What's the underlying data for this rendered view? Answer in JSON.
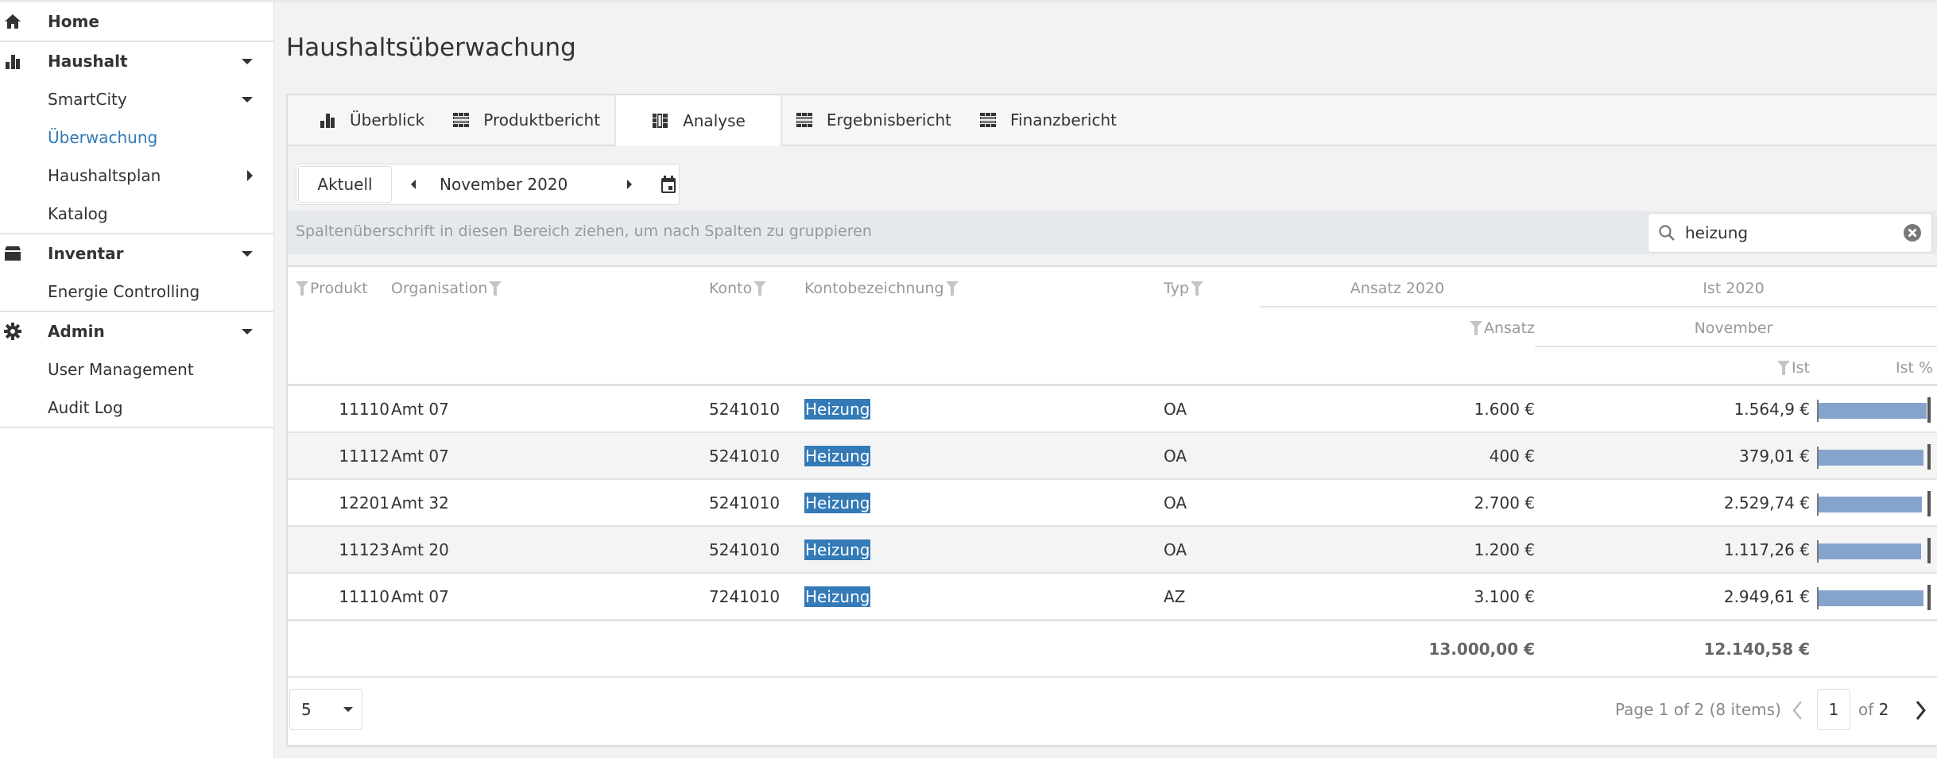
{
  "sidebar": {
    "groups": [
      {
        "items": [
          {
            "label": "Home",
            "icon": "home-icon",
            "head": true
          }
        ]
      },
      {
        "items": [
          {
            "label": "Haushalt",
            "icon": "bar-chart-icon",
            "head": true,
            "caret": "down"
          },
          {
            "label": "SmartCity",
            "caret": "down"
          },
          {
            "label": "Überwachung",
            "active": true
          },
          {
            "label": "Haushaltsplan",
            "caret": "right"
          },
          {
            "label": "Katalog"
          }
        ]
      },
      {
        "items": [
          {
            "label": "Inventar",
            "icon": "archive-icon",
            "head": true,
            "caret": "down"
          },
          {
            "label": "Energie Controlling"
          }
        ]
      },
      {
        "items": [
          {
            "label": "Admin",
            "icon": "gear-icon",
            "head": true,
            "caret": "down"
          },
          {
            "label": "User Management"
          },
          {
            "label": "Audit Log"
          }
        ]
      }
    ]
  },
  "page": {
    "title": "Haushaltsüberwachung"
  },
  "tabs": [
    {
      "label": "Überblick",
      "icon": "bar-chart-icon"
    },
    {
      "label": "Produktbericht",
      "icon": "table-icon"
    },
    {
      "label": "Analyse",
      "icon": "pivot-icon",
      "active": true
    },
    {
      "label": "Ergebnisbericht",
      "icon": "table-icon"
    },
    {
      "label": "Finanzbericht",
      "icon": "table-icon"
    }
  ],
  "toolbar": {
    "current_label": "Aktuell",
    "period": "November 2020"
  },
  "group_panel": {
    "hint": "Spaltenüberschrift in diesen Bereich ziehen, um nach Spalten zu gruppieren"
  },
  "search": {
    "value": "heizung"
  },
  "columns": {
    "produkt": "Produkt",
    "organisation": "Organisation",
    "konto": "Konto",
    "kontobezeichnung": "Kontobezeichnung",
    "typ": "Typ",
    "ansatz_group": "Ansatz 2020",
    "ist_group": "Ist 2020",
    "ansatz": "Ansatz",
    "month": "November",
    "ist": "Ist",
    "ist_pct": "Ist %"
  },
  "rows": [
    {
      "produkt": "11110",
      "organisation": "Amt 07",
      "konto": "5241010",
      "bezeichnung": "Heizung",
      "typ": "OA",
      "ansatz": "1.600 €",
      "ist": "1.564,9 €",
      "ist_pct": 0.978
    },
    {
      "produkt": "11112",
      "organisation": "Amt 07",
      "konto": "5241010",
      "bezeichnung": "Heizung",
      "typ": "OA",
      "ansatz": "400 €",
      "ist": "379,01 €",
      "ist_pct": 0.948
    },
    {
      "produkt": "12201",
      "organisation": "Amt 32",
      "konto": "5241010",
      "bezeichnung": "Heizung",
      "typ": "OA",
      "ansatz": "2.700 €",
      "ist": "2.529,74 €",
      "ist_pct": 0.937
    },
    {
      "produkt": "11123",
      "organisation": "Amt 20",
      "konto": "5241010",
      "bezeichnung": "Heizung",
      "typ": "OA",
      "ansatz": "1.200 €",
      "ist": "1.117,26 €",
      "ist_pct": 0.931
    },
    {
      "produkt": "11110",
      "organisation": "Amt 07",
      "konto": "7241010",
      "bezeichnung": "Heizung",
      "typ": "AZ",
      "ansatz": "3.100 €",
      "ist": "2.949,61 €",
      "ist_pct": 0.951
    }
  ],
  "totals": {
    "ansatz": "13.000,00 €",
    "ist": "12.140,58 €"
  },
  "pager": {
    "page_size": "5",
    "info": "Page 1 of 2 (8 items)",
    "current": "1",
    "of_label": "of",
    "total_pages": "2"
  },
  "colors": {
    "accent": "#337ab7",
    "bar": "#86a3cb",
    "highlight": "#337ab7"
  }
}
